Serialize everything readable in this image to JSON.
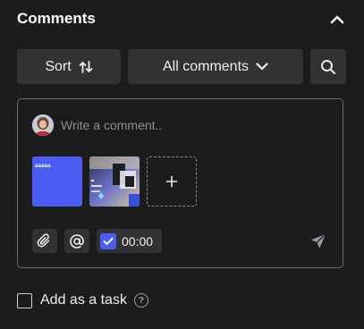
{
  "panel": {
    "title": "Comments",
    "collapse_icon": "chevron-up-icon"
  },
  "toolbar": {
    "sort_label": "Sort",
    "sort_icon": "sort-arrows-icon",
    "filter_label": "All comments",
    "filter_icon": "chevron-down-icon",
    "search_icon": "search-icon"
  },
  "composer": {
    "placeholder": "Write a comment..",
    "attachments": [
      {
        "label": "",
        "thumb_text": "aaaaa"
      },
      {
        "label": ""
      }
    ],
    "add_attachment_icon": "plus-icon",
    "attach_icon": "paperclip-icon",
    "mention_icon": "at-icon",
    "timestamp_checked": true,
    "timestamp": "00:00",
    "send_icon": "send-icon"
  },
  "task": {
    "label": "Add as a task",
    "checked": false,
    "help_icon": "question-icon",
    "help_glyph": "?"
  },
  "colors": {
    "background": "#1c1c1e",
    "button": "#323235",
    "accent": "#4a5cf2",
    "border": "#6a6a6e"
  }
}
